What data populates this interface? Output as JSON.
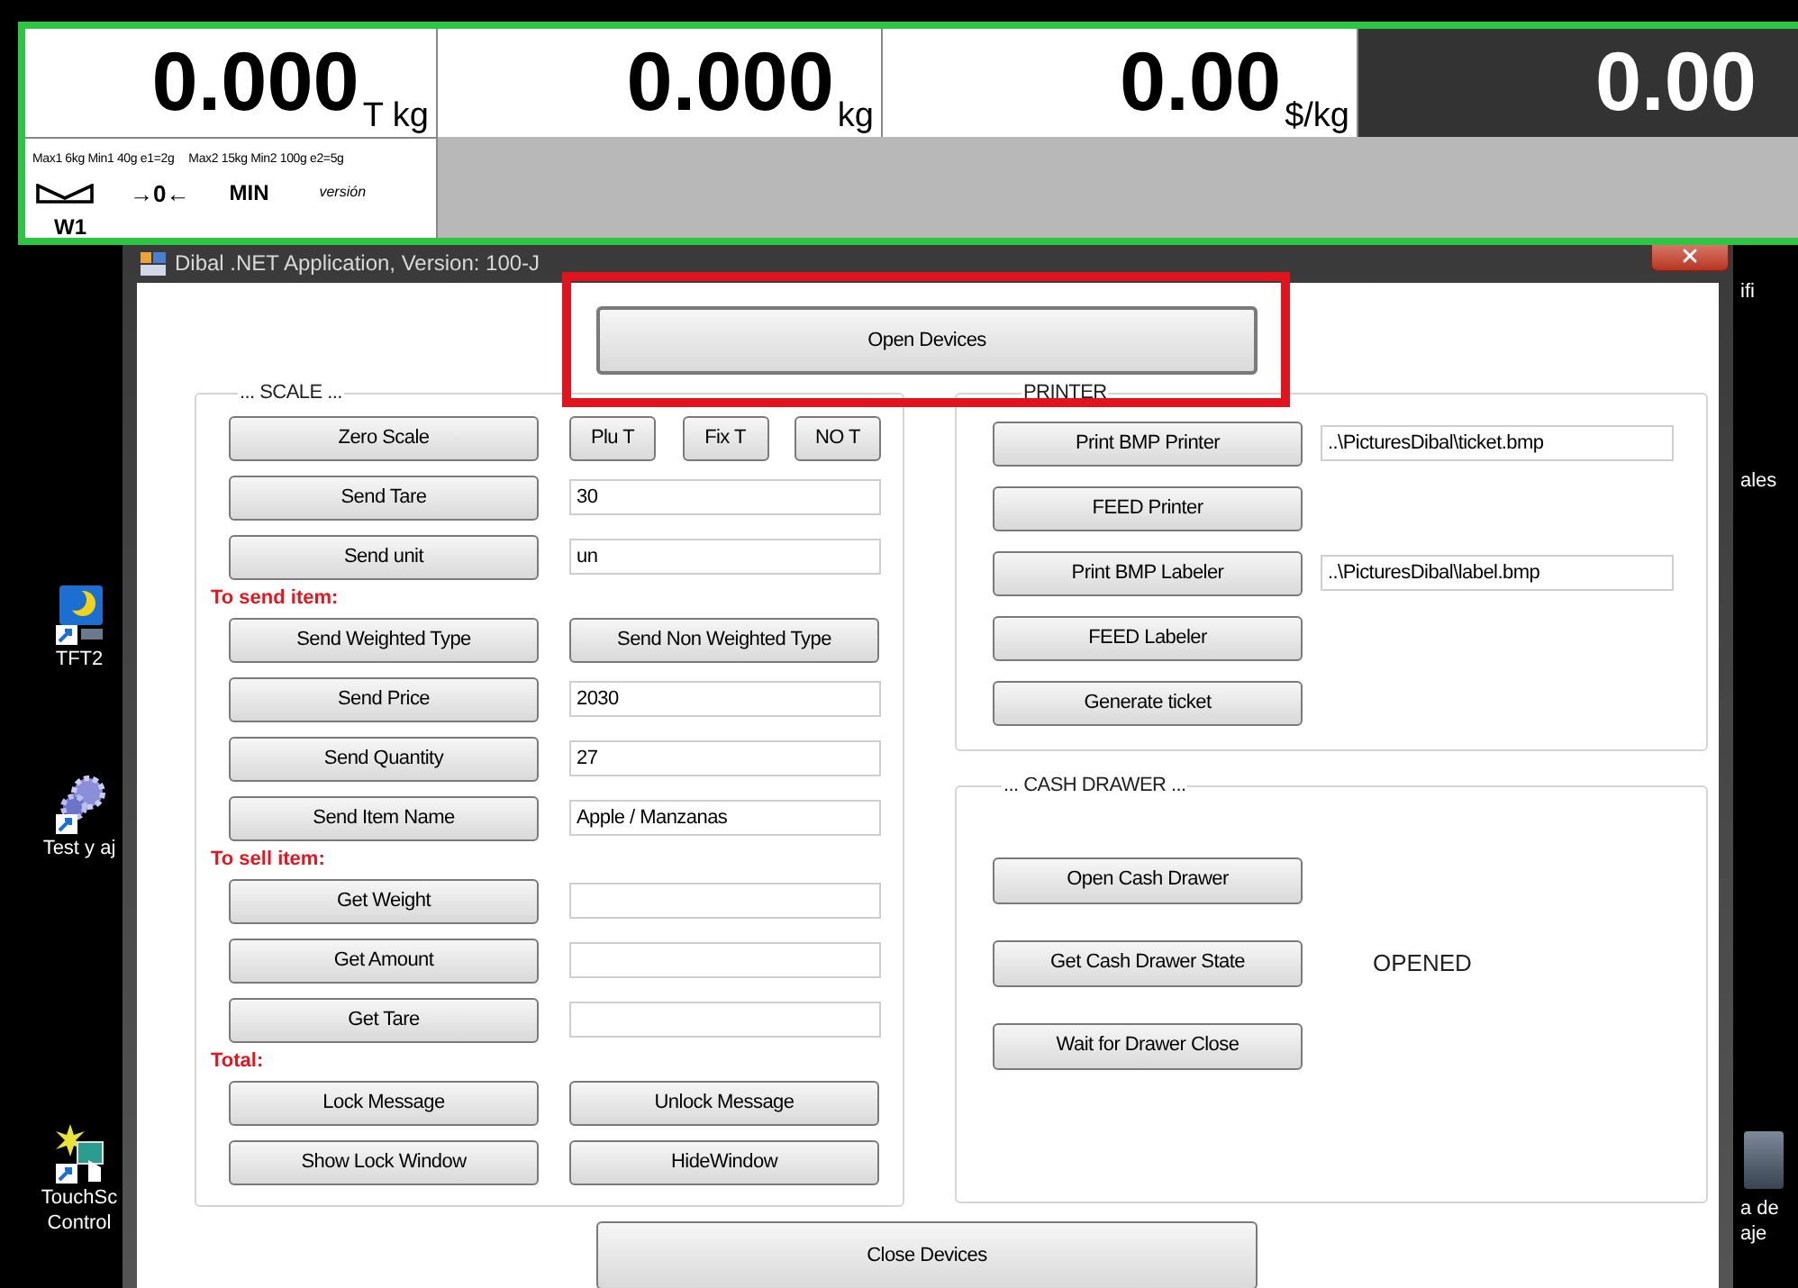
{
  "header": {
    "displays": [
      {
        "kind": "light",
        "value": "0.000",
        "unit": "T kg"
      },
      {
        "kind": "light",
        "value": "0.000",
        "unit": "kg"
      },
      {
        "kind": "light",
        "value": "0.00",
        "unit": "$/kg"
      },
      {
        "kind": "dark",
        "value": "0.00"
      }
    ],
    "info": {
      "range_1": "Max1 6kg Min1 40g e1=2g",
      "range_2": "Max2 15kg Min2 100g e2=5g",
      "zero": "→0←",
      "min": "MIN",
      "version": "versión",
      "scale_id": "W1"
    }
  },
  "desktop": {
    "left_icons": [
      {
        "kind": "moon",
        "label_lines": [
          "TFT2"
        ]
      },
      {
        "kind": "gears",
        "label_lines": [
          "Test y aj"
        ]
      },
      {
        "kind": "touch",
        "label_lines": [
          "TouchSc",
          "Control"
        ]
      }
    ],
    "right_labels": [
      {
        "label_lines": [
          "ifi"
        ]
      },
      {
        "label_lines": [
          "ales"
        ]
      },
      {
        "label_lines": [
          "a de",
          "aje"
        ]
      }
    ]
  },
  "window": {
    "title": "Dibal .NET Application, Version: 100-J",
    "open_button": "Open Devices",
    "close_button": "Close Devices",
    "scale": {
      "title": "... SCALE ...",
      "rows": [
        {
          "kind": "row",
          "cells": [
            {
              "kind": "button",
              "label": "Zero Scale"
            },
            {
              "kind": "small_buttons",
              "labels": [
                "Plu T",
                "Fix T",
                "NO T"
              ]
            }
          ]
        },
        {
          "kind": "row",
          "cells": [
            {
              "kind": "button",
              "label": "Send Tare"
            },
            {
              "kind": "field",
              "value": "30"
            }
          ]
        },
        {
          "kind": "row",
          "cells": [
            {
              "kind": "button",
              "label": "Send unit"
            },
            {
              "kind": "field",
              "value": "un"
            }
          ]
        },
        {
          "kind": "heading",
          "text": "To send item:"
        },
        {
          "kind": "row",
          "cells": [
            {
              "kind": "button",
              "label": "Send Weighted Type"
            },
            {
              "kind": "button",
              "label": "Send Non Weighted Type"
            }
          ]
        },
        {
          "kind": "row",
          "cells": [
            {
              "kind": "button",
              "label": "Send Price"
            },
            {
              "kind": "field",
              "value": "2030"
            }
          ]
        },
        {
          "kind": "row",
          "cells": [
            {
              "kind": "button",
              "label": "Send Quantity"
            },
            {
              "kind": "field",
              "value": "27"
            }
          ]
        },
        {
          "kind": "row",
          "cells": [
            {
              "kind": "button",
              "label": "Send Item Name"
            },
            {
              "kind": "field",
              "value": "Apple / Manzanas"
            }
          ]
        },
        {
          "kind": "heading",
          "text": "To sell item:"
        },
        {
          "kind": "row",
          "cells": [
            {
              "kind": "button",
              "label": "Get Weight"
            },
            {
              "kind": "field"
            }
          ]
        },
        {
          "kind": "row",
          "cells": [
            {
              "kind": "button",
              "label": "Get Amount"
            },
            {
              "kind": "field"
            }
          ]
        },
        {
          "kind": "row",
          "cells": [
            {
              "kind": "button",
              "label": "Get Tare"
            },
            {
              "kind": "field"
            }
          ]
        },
        {
          "kind": "heading",
          "text": "Total:"
        },
        {
          "kind": "row",
          "cells": [
            {
              "kind": "button",
              "label": "Lock Message"
            },
            {
              "kind": "button",
              "label": "Unlock Message"
            }
          ]
        },
        {
          "kind": "row",
          "cells": [
            {
              "kind": "button",
              "label": "Show Lock Window"
            },
            {
              "kind": "button",
              "label": "HideWindow"
            }
          ]
        }
      ]
    },
    "printer": {
      "title": "PRINTER",
      "rows": [
        {
          "button": "Print BMP Printer",
          "field": "..\\PicturesDibal\\ticket.bmp"
        },
        {
          "button": "FEED Printer"
        },
        {
          "button": "Print BMP Labeler",
          "field": "..\\PicturesDibal\\label.bmp"
        },
        {
          "button": "FEED Labeler"
        },
        {
          "button": "Generate ticket"
        }
      ]
    },
    "cash_drawer": {
      "title": "... CASH DRAWER ...",
      "rows": [
        {
          "button": "Open Cash Drawer"
        },
        {
          "button": "Get Cash Drawer State",
          "status": "OPENED"
        },
        {
          "button": "Wait for Drawer Close"
        }
      ]
    }
  }
}
